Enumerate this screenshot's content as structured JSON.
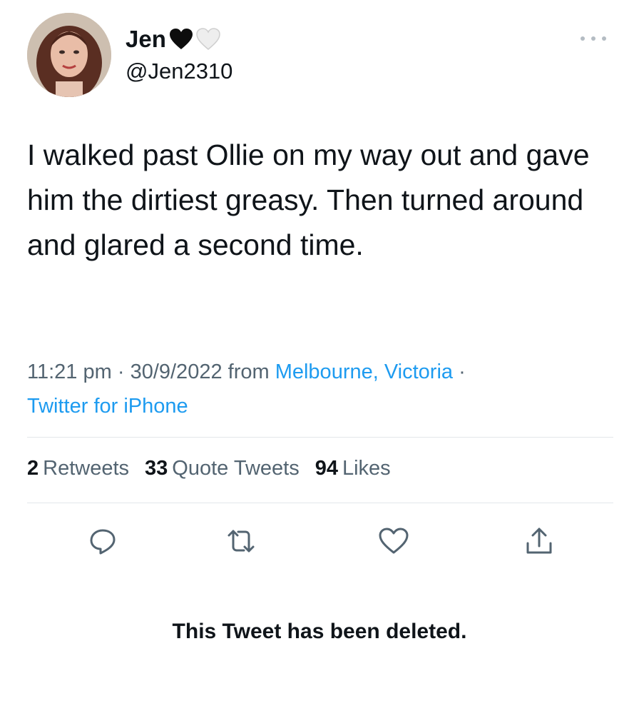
{
  "author": {
    "display_name": "Jen",
    "handle": "@Jen2310",
    "name_emojis": [
      "black-heart",
      "white-heart"
    ]
  },
  "tweet": {
    "text": "I walked past Ollie on my way out and gave him the dirtiest greasy. Then turned around and glared a second time.",
    "time": "11:21 pm",
    "date": "30/9/2022",
    "from_label": "from",
    "location": "Melbourne, Victoria",
    "source": "Twitter for iPhone",
    "separator": "·"
  },
  "stats": {
    "retweets_count": "2",
    "retweets_label": "Retweets",
    "quote_tweets_count": "33",
    "quote_tweets_label": "Quote Tweets",
    "likes_count": "94",
    "likes_label": "Likes"
  },
  "actions": {
    "icons": [
      "reply-icon",
      "retweet-icon",
      "like-icon",
      "share-icon"
    ]
  },
  "status": {
    "deleted_message": "This Tweet has been deleted."
  },
  "colors": {
    "text": "#0f1419",
    "secondary": "#536471",
    "link": "#1d9bf0",
    "divider": "#e3e7ea"
  }
}
